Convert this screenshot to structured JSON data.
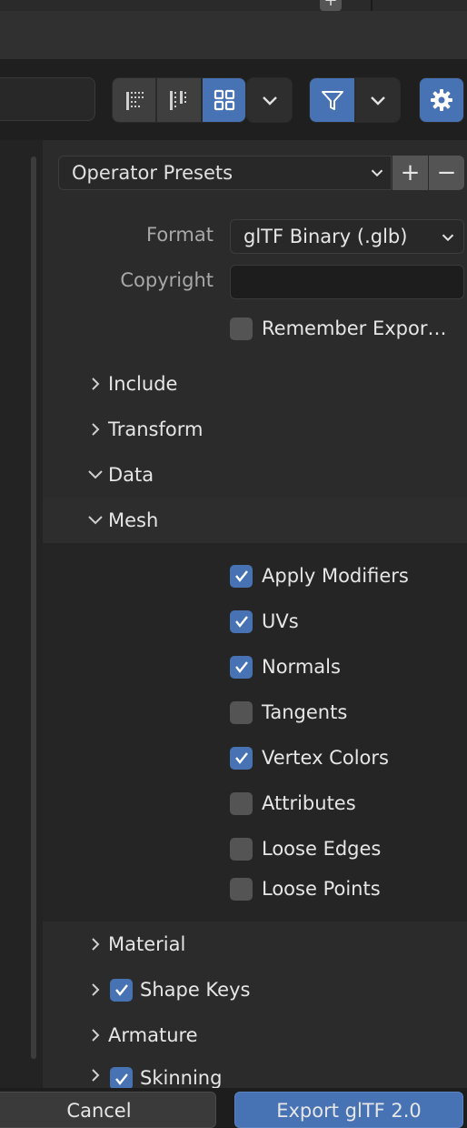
{
  "presets": {
    "label": "Operator Presets",
    "add_symbol": "+",
    "remove_symbol": "−"
  },
  "top_strip": {
    "plus_symbol": "+"
  },
  "format": {
    "label": "Format",
    "value": "glTF Binary (.glb)"
  },
  "copyright": {
    "label": "Copyright",
    "value": ""
  },
  "remember_export": {
    "label": "Remember Expor…",
    "checked": false
  },
  "sections": {
    "include": "Include",
    "transform": "Transform",
    "data": "Data",
    "mesh": "Mesh",
    "material": "Material",
    "shape_keys": "Shape Keys",
    "armature": "Armature",
    "skinning": "Skinning"
  },
  "mesh_options": [
    {
      "label": "Apply Modifiers",
      "checked": true
    },
    {
      "label": "UVs",
      "checked": true
    },
    {
      "label": "Normals",
      "checked": true
    },
    {
      "label": "Tangents",
      "checked": false
    },
    {
      "label": "Vertex Colors",
      "checked": true
    },
    {
      "label": "Attributes",
      "checked": false
    },
    {
      "label": "Loose Edges",
      "checked": false
    },
    {
      "label": "Loose Points",
      "checked": false
    }
  ],
  "footer": {
    "cancel_label": "Cancel",
    "export_label": "Export glTF 2.0"
  },
  "colors": {
    "accent": "#4772b3",
    "panel": "#2b2b2b",
    "field": "#1d1d1d"
  },
  "icons": {
    "display_mode_vertical_list": "list-vertical-icon",
    "display_mode_horizontal_list": "list-horizontal-icon",
    "display_mode_thumbnails": "thumbnails-icon",
    "filter": "filter-funnel-icon",
    "settings": "gear-icon"
  }
}
